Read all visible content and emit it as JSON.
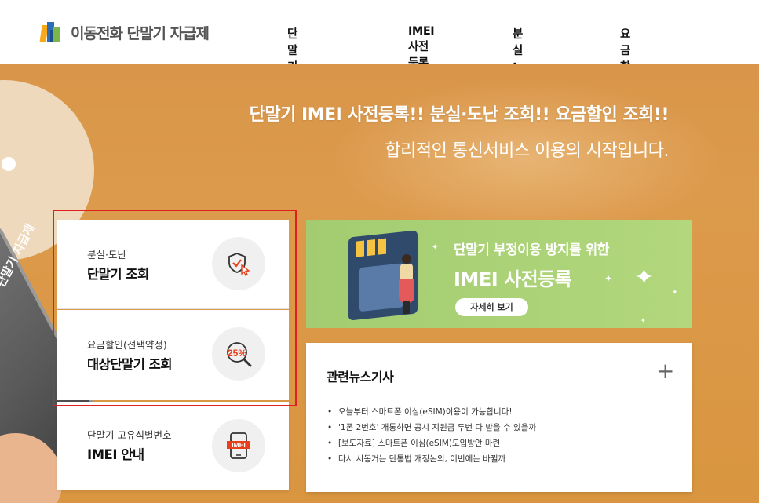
{
  "header": {
    "logo_text": "이동전화 단말기 자급제",
    "nav": [
      "단말기자급제 소개",
      "IMEI 사전등록",
      "분실 · 도난 조회",
      "요금할인 조회"
    ]
  },
  "hero": {
    "title": "단말기 IMEI 사전등록!! 분실·도난 조회!! 요금할인 조회!!",
    "subtitle": "합리적인 통신서비스 이용의 시작입니다.",
    "phone_text": "단말기 자급제"
  },
  "quick_cards": [
    {
      "sub": "분실·도난",
      "main": "단말기 조회",
      "icon": "shield-cursor-icon"
    },
    {
      "sub": "요금할인(선택약정)",
      "main": "대상단말기 조회",
      "icon": "magnifier-25-icon",
      "badge": "25%"
    },
    {
      "sub": "단말기 고유식별번호",
      "main": "IMEI 안내",
      "icon": "phone-imei-icon",
      "badge": "IMEI"
    }
  ],
  "banner": {
    "line1": "단말기 부정이용 방지를 위한",
    "line2": "IMEI 사전등록",
    "button": "자세히 보기"
  },
  "news": {
    "title": "관련뉴스기사",
    "more": "+",
    "items": [
      "오늘부터 스마트폰 이심(eSIM)이용이 가능합니다!",
      "'1폰 2번호' 개통하면 공시 지원금 두번 다 받을 수 있을까",
      "[보도자료] 스마트폰 이심(eSIM)도입방안 마련",
      "다시 시동거는 단통법 개정논의, 이번에는 바뀔까"
    ]
  },
  "colors": {
    "hero_bg": "#d9964a",
    "banner_bg": "#a8d073",
    "highlight_border": "#e02020",
    "icon_accent": "#e8401c"
  }
}
